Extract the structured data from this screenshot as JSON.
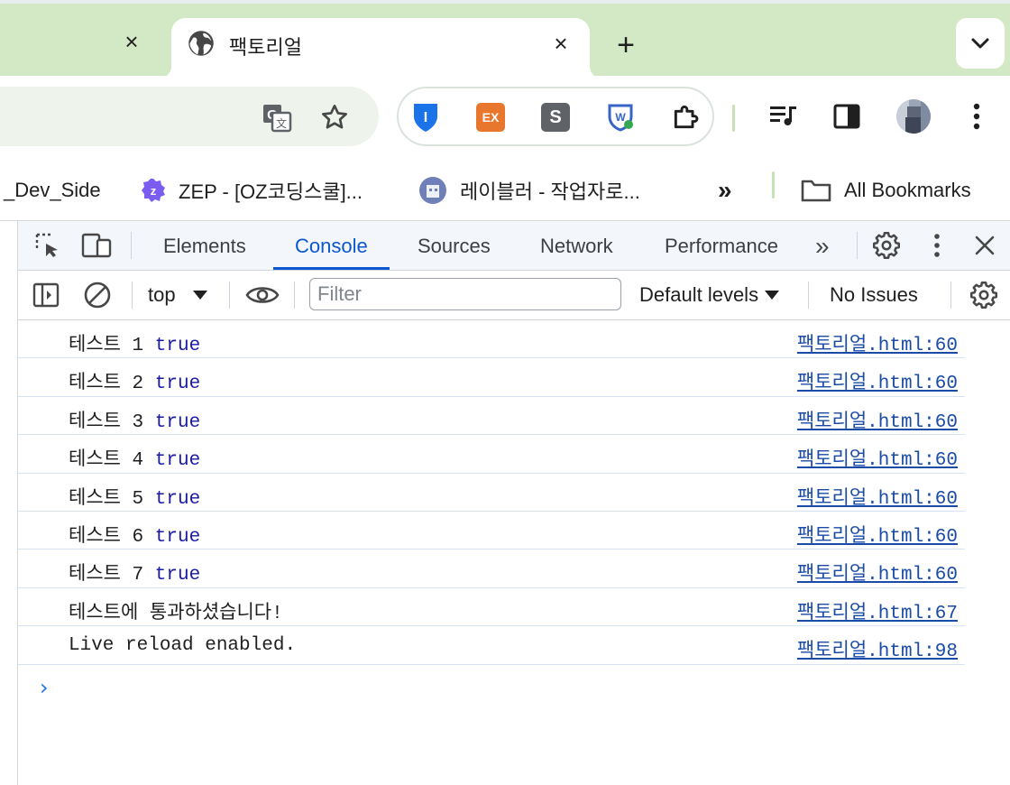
{
  "tabs": {
    "inactive_close": "×",
    "active": {
      "title": "팩토리얼",
      "close": "×"
    },
    "new_tab": "+",
    "search_tabs": "⌄"
  },
  "toolbar": {
    "extensions": [
      {
        "name": "bitwarden",
        "label": "I",
        "color": "#1a73e8"
      },
      {
        "name": "ex",
        "label": "EX",
        "color": "#e8762c"
      },
      {
        "name": "s",
        "label": "S",
        "color": "#5f6368"
      },
      {
        "name": "w",
        "label": "W",
        "color": "#3a63c7"
      }
    ]
  },
  "bookmarks": [
    {
      "label": "_Dev_Side"
    },
    {
      "label": "ZEP - [OZ코딩스쿨]..."
    },
    {
      "label": "레이블러 - 작업자로..."
    }
  ],
  "bookmarks_more": "»",
  "all_bookmarks": "All Bookmarks",
  "devtools": {
    "tabs": [
      "Elements",
      "Console",
      "Sources",
      "Network",
      "Performance"
    ],
    "more_tabs": "»",
    "context": "top",
    "filter_placeholder": "Filter",
    "levels": "Default levels",
    "issues": "No Issues",
    "logs": [
      {
        "text": "테스트 1 ",
        "bool": "true",
        "source": "팩토리얼.html:60"
      },
      {
        "text": "테스트 2 ",
        "bool": "true",
        "source": "팩토리얼.html:60"
      },
      {
        "text": "테스트 3 ",
        "bool": "true",
        "source": "팩토리얼.html:60"
      },
      {
        "text": "테스트 4 ",
        "bool": "true",
        "source": "팩토리얼.html:60"
      },
      {
        "text": "테스트 5 ",
        "bool": "true",
        "source": "팩토리얼.html:60"
      },
      {
        "text": "테스트 6 ",
        "bool": "true",
        "source": "팩토리얼.html:60"
      },
      {
        "text": "테스트 7 ",
        "bool": "true",
        "source": "팩토리얼.html:60"
      },
      {
        "text": "테스트에 통과하셨습니다!",
        "bool": "",
        "source": "팩토리얼.html:67"
      },
      {
        "text": "Live reload enabled.",
        "bool": "",
        "source": "팩토리얼.html:98"
      }
    ],
    "prompt": "›"
  }
}
